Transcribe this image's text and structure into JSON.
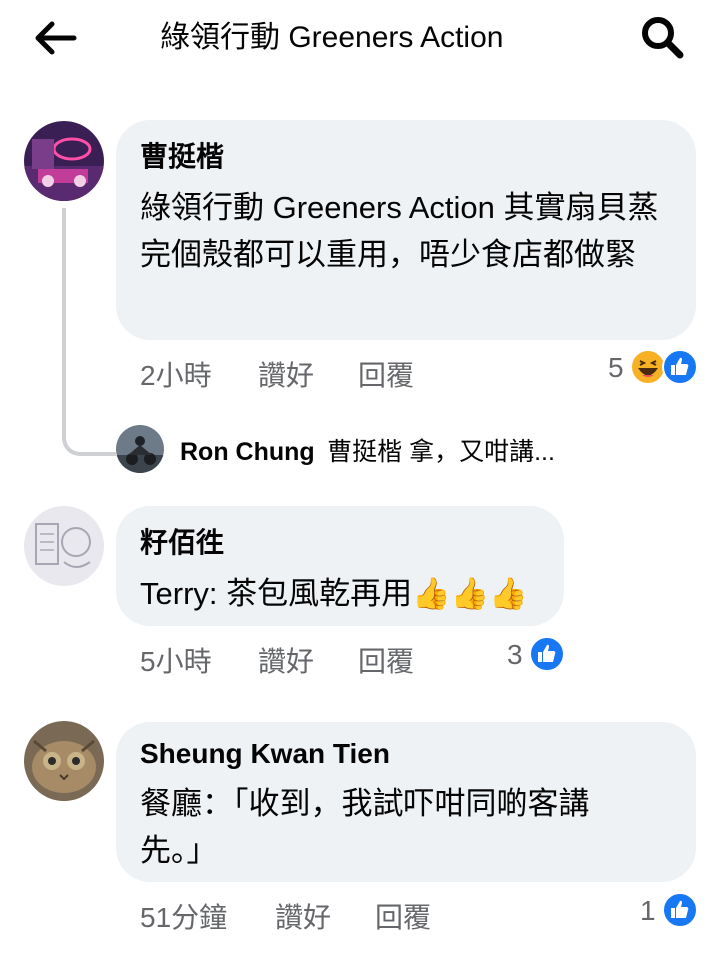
{
  "header": {
    "title": "綠領行動 Greeners Action",
    "back_icon": "arrow-left-icon",
    "search_icon": "search-icon"
  },
  "comments": [
    {
      "author": "曹挺楷",
      "text": "綠領行動 Greeners Action 其實扇貝蒸完個殼都可以重用，唔少食店都做緊",
      "time": "2小時",
      "like_label": "讚好",
      "reply_label": "回覆",
      "reaction_count": "5",
      "reactions": [
        "haha-icon",
        "like-icon"
      ],
      "reply_preview": {
        "author": "Ron Chung",
        "text": "曹挺楷 拿，又咁講..."
      }
    },
    {
      "author": "籽佰徃",
      "text": "Terry: 茶包風乾再用👍👍👍",
      "time": "5小時",
      "like_label": "讚好",
      "reply_label": "回覆",
      "reaction_count": "3",
      "reactions": [
        "like-icon"
      ]
    },
    {
      "author": "Sheung Kwan Tien",
      "text": "餐廳：「收到，我試吓咁同啲客講先。」",
      "time": "51分鐘",
      "like_label": "讚好",
      "reply_label": "回覆",
      "reaction_count": "1",
      "reactions": [
        "like-icon"
      ]
    }
  ],
  "colors": {
    "bubble": "#eff2f5",
    "meta_text": "#65676b",
    "like_blue": "#1877f2",
    "haha_yellow": "#f7b125"
  }
}
